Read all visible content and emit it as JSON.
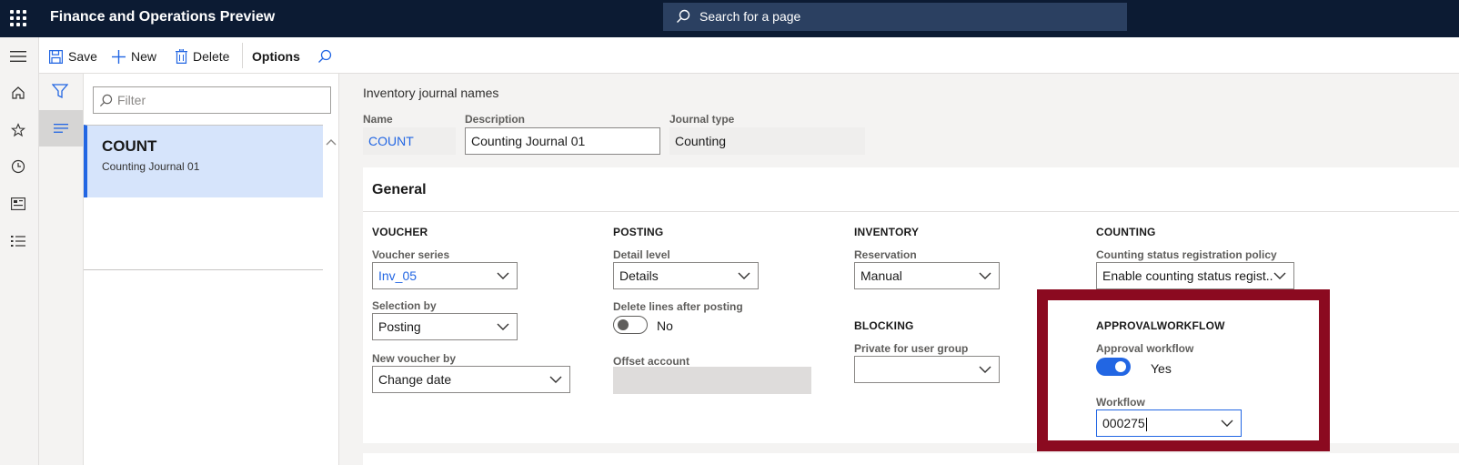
{
  "app": {
    "title": "Finance and Operations Preview"
  },
  "search": {
    "placeholder": "Search for a page"
  },
  "toolbar": {
    "save": "Save",
    "new": "New",
    "delete": "Delete",
    "options": "Options"
  },
  "nav": {
    "icons": [
      "home-icon",
      "star-icon",
      "clock-icon",
      "workspace-icon",
      "modules-icon"
    ]
  },
  "listpane": {
    "filter_placeholder": "Filter",
    "items": [
      {
        "title": "COUNT",
        "subtitle": "Counting Journal 01"
      }
    ]
  },
  "page": {
    "heading": "Inventory journal names"
  },
  "header_fields": {
    "name_label": "Name",
    "name_value": "COUNT",
    "description_label": "Description",
    "description_value": "Counting Journal 01",
    "journal_type_label": "Journal type",
    "journal_type_value": "Counting"
  },
  "general": {
    "title": "General",
    "voucher": {
      "heading": "VOUCHER",
      "voucher_series_label": "Voucher series",
      "voucher_series_value": "Inv_05",
      "selection_by_label": "Selection by",
      "selection_by_value": "Posting",
      "new_voucher_by_label": "New voucher by",
      "new_voucher_by_value": "Change date"
    },
    "posting": {
      "heading": "POSTING",
      "detail_level_label": "Detail level",
      "detail_level_value": "Details",
      "delete_lines_label": "Delete lines after posting",
      "delete_lines_value": "No",
      "offset_account_label": "Offset account",
      "offset_account_value": ""
    },
    "inventory": {
      "heading": "INVENTORY",
      "reservation_label": "Reservation",
      "reservation_value": "Manual"
    },
    "blocking": {
      "heading": "BLOCKING",
      "private_label": "Private for user group",
      "private_value": ""
    },
    "counting": {
      "heading": "COUNTING",
      "policy_label": "Counting status registration policy",
      "policy_value": "Enable counting status regist..."
    },
    "approval": {
      "heading": "APPROVALWORKFLOW",
      "approval_label": "Approval workflow",
      "approval_value": "Yes",
      "workflow_label": "Workflow",
      "workflow_value": "000275"
    }
  },
  "colors": {
    "topbar": "#0c1b33",
    "accent": "#2266e3",
    "highlight": "#8b0a20",
    "selected_row": "#d6e4fb"
  }
}
